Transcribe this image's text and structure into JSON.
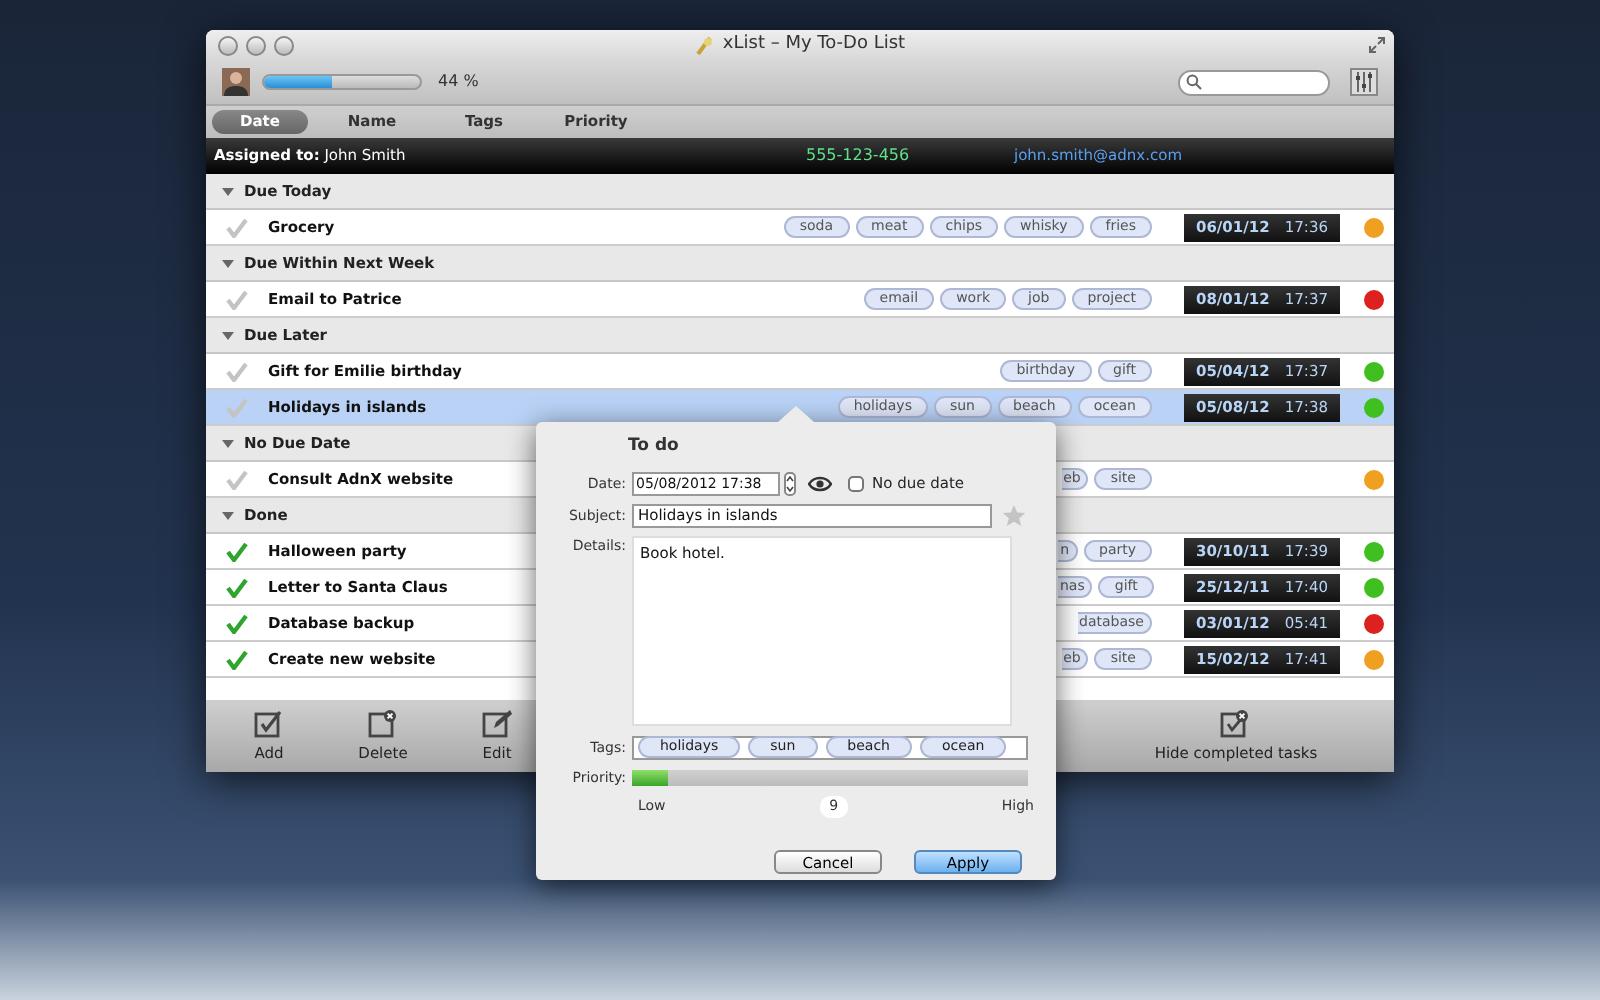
{
  "window": {
    "title": "xList – My To-Do List"
  },
  "toolbar": {
    "progress": {
      "level": 0.44,
      "reading": "44 %"
    }
  },
  "sort_tabs": [
    {
      "label": "Date",
      "selected": true
    },
    {
      "label": "Name",
      "selected": false
    },
    {
      "label": "Tags",
      "selected": false
    },
    {
      "label": "Priority",
      "selected": false
    }
  ],
  "assigned": {
    "text": "**Assigned to:** John Smith",
    "phone": "555-123-456",
    "email": "john.smith@adnx.com"
  },
  "groups": [
    {
      "title": "Due Today",
      "expanded": true,
      "tasks": [
        {
          "name": "Grocery",
          "done": false,
          "selected": false,
          "tags": [
            "soda",
            "meat",
            "chips",
            "whisky",
            "fries"
          ],
          "date": "06/01/12",
          "time": "17:36",
          "color": "#f0a020"
        }
      ]
    },
    {
      "title": "Due Within Next Week",
      "expanded": true,
      "tasks": [
        {
          "name": "Email to Patrice",
          "done": false,
          "selected": false,
          "tags": [
            "email",
            "work",
            "job",
            "project"
          ],
          "date": "08/01/12",
          "time": "17:37",
          "color": "#dd2020"
        }
      ]
    },
    {
      "title": "Due Later",
      "expanded": true,
      "tasks": [
        {
          "name": "Gift for Emilie birthday",
          "done": false,
          "selected": false,
          "tags": [
            "birthday",
            "gift"
          ],
          "date": "05/04/12",
          "time": "17:37",
          "color": "#40c020"
        },
        {
          "name": "Holidays in islands",
          "done": false,
          "selected": true,
          "tags": [
            "holidays",
            "sun",
            "beach",
            "ocean"
          ],
          "date": "05/08/12",
          "time": "17:38",
          "color": "#40c020"
        }
      ]
    },
    {
      "title": "No Due Date",
      "expanded": true,
      "tasks": [
        {
          "name": "Consult AdnX website",
          "done": false,
          "selected": false,
          "tags": [
            "eb",
            "site"
          ],
          "color": "#f0a020"
        }
      ]
    },
    {
      "title": "Done",
      "expanded": true,
      "tasks": [
        {
          "name": "Halloween party",
          "done": true,
          "selected": false,
          "tags": [
            "n",
            "party"
          ],
          "date": "30/10/11",
          "time": "17:39",
          "color": "#40c020"
        },
        {
          "name": "Letter to Santa Claus",
          "done": true,
          "selected": false,
          "tags": [
            "nas",
            "gift"
          ],
          "date": "25/12/11",
          "time": "17:40",
          "color": "#40c020"
        },
        {
          "name": "Database backup",
          "done": true,
          "selected": false,
          "tags": [
            "database"
          ],
          "date": "03/01/12",
          "time": "05:41",
          "color": "#dd2020"
        },
        {
          "name": "Create new website",
          "done": true,
          "selected": false,
          "tags": [
            "eb",
            "site"
          ],
          "date": "15/02/12",
          "time": "17:41",
          "color": "#f0a020"
        }
      ]
    }
  ],
  "bottom_toolbar": {
    "buttons": [
      {
        "kind": "add",
        "label": "Add"
      },
      {
        "kind": "delete",
        "label": "Delete"
      },
      {
        "kind": "edit",
        "label": "Edit"
      }
    ],
    "hide_button": {
      "label": "Hide completed tasks"
    }
  },
  "editor": {
    "title": "To do",
    "date_label": "Date:",
    "date": "05/08/2012 17:38",
    "no_due_date": {
      "label": "No due date",
      "checked": false
    },
    "subject_label": "Subject:",
    "subject": "Holidays in islands",
    "starred": false,
    "details_label": "Details:",
    "details": "Book hotel.",
    "tags_label": "Tags:",
    "tags": [
      "holidays",
      "sun",
      "beach",
      "ocean"
    ],
    "priority_label": "Priority:",
    "priority": {
      "level": 0.09,
      "low": "Low",
      "value": "9",
      "high": "High"
    },
    "buttons": [
      {
        "label": "Cancel",
        "kind": "cancel"
      },
      {
        "label": "Apply",
        "kind": "apply"
      }
    ]
  }
}
